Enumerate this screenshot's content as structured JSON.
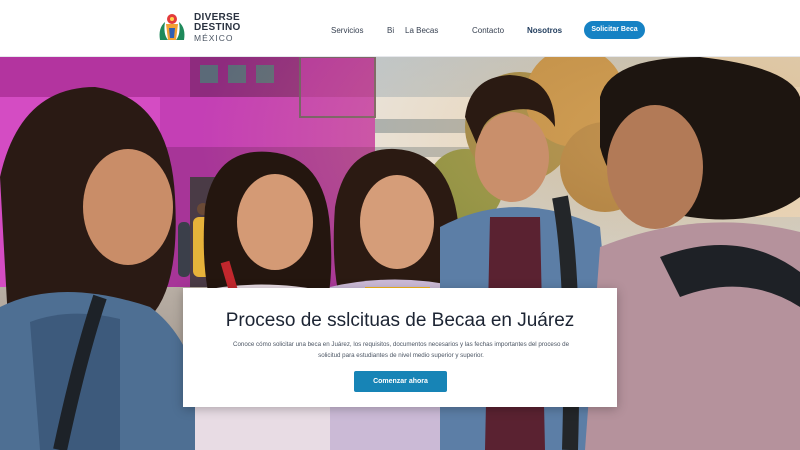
{
  "brand": {
    "line1": "DIVERSE",
    "line2": "DESTINO",
    "line3": "MÉXICO"
  },
  "nav": {
    "links": [
      "Servicios",
      "Bi",
      "La Becas",
      "Contacto",
      "Nosotros"
    ],
    "cta_label": "Solicitar Beca"
  },
  "hero_card": {
    "title": "Proceso de sslcituas de Becaa en Juárez",
    "description": "Conoce cómo solicitar una beca en Juárez, los requisitos, documentos necesarios y las fechas importantes del proceso de solicitud para estudiantes de nivel medio superior y superior.",
    "button_label": "Comenzar ahora"
  },
  "colors": {
    "accent": "#1682c4",
    "button": "#1784b6",
    "building_magenta": "#c43fb5"
  }
}
